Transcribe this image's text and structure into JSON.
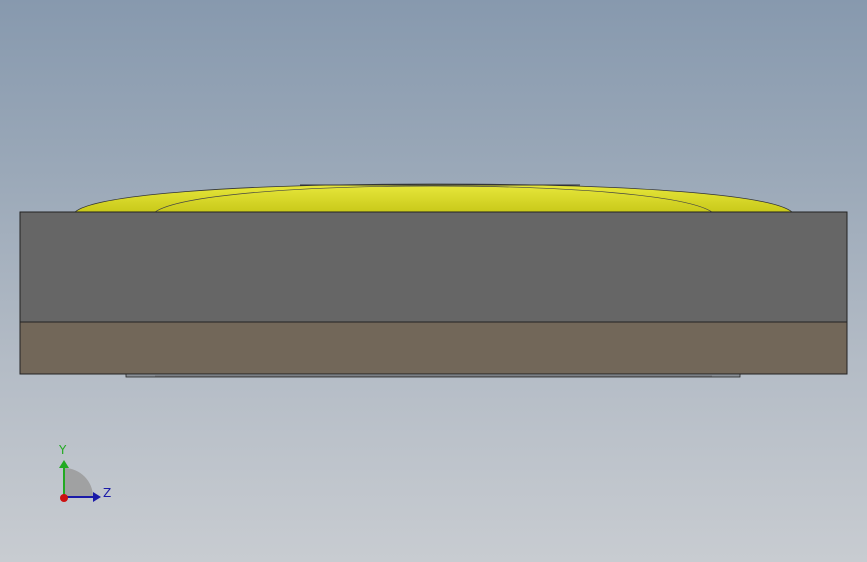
{
  "viewport": {
    "background_top": "#8799ae",
    "background_bottom": "#c8ccd1"
  },
  "model": {
    "dome_color": "#d2d21e",
    "dome_highlight": "#e6e63a",
    "upper_block_color": "#666666",
    "lower_block_color": "#726759",
    "edge_color": "#222222"
  },
  "triad": {
    "y_label": "Y",
    "z_label": "Z",
    "y_color": "#22aa22",
    "z_color": "#1a1aa8",
    "x_color": "#cc1111"
  }
}
